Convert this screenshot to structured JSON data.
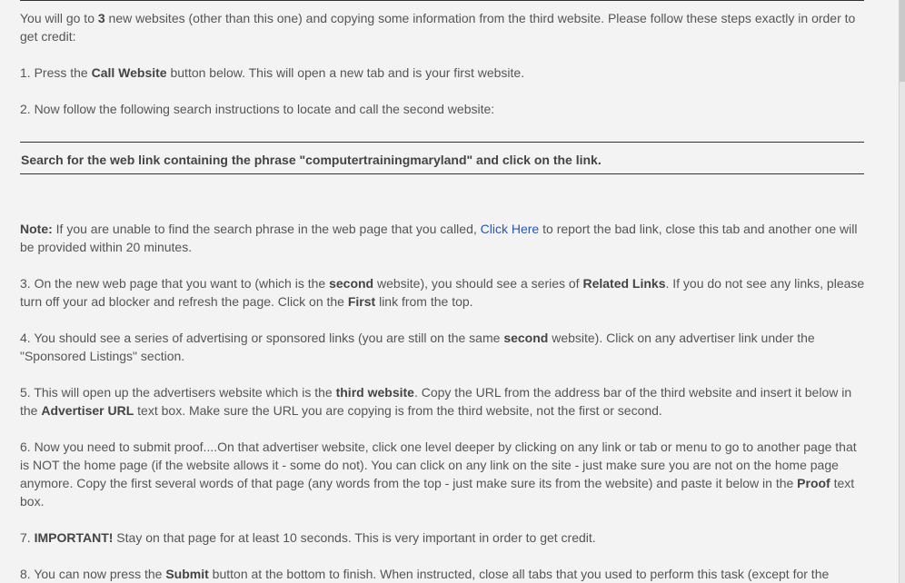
{
  "intro": {
    "t1": "You will go to ",
    "b1": "3",
    "t2": " new websites (other than this one) and copying some information from the third website. Please follow these steps exactly in order to get credit:"
  },
  "step1": {
    "t1": "1. Press the ",
    "b1": "Call Website",
    "t2": " button below. This will open a new tab and is your first website."
  },
  "step2": {
    "t1": "2. Now follow the following search instructions to locate and call the second website:"
  },
  "search_instruction": "Search for the web link containing the phrase \"computertrainingmaryland\" and click on the link.",
  "note": {
    "label": "Note:",
    "t1": " If you are unable to find the search phrase in the web page that you called, ",
    "link": "Click Here",
    "t2": " to report the bad link, close this tab and another one will be provided within 20 minutes."
  },
  "step3": {
    "t1": "3. On the new web page that you want to (which is the ",
    "b1": "second",
    "t2": " website), you should see a series of ",
    "b2": "Related Links",
    "t3": ". If you do not see any links, please turn off your ad blocker and refresh the page. Click on the ",
    "b3": "First",
    "t4": " link from the top."
  },
  "step4": {
    "t1": "4. You should see a series of advertising or sponsored links (you are still on the same ",
    "b1": "second",
    "t2": " website). Click on any advertiser link under the \"Sponsored Listings\" section."
  },
  "step5": {
    "t1": "5. This will open up the advertisers website which is the ",
    "b1": "third website",
    "t2": ". Copy the URL from the address bar of the third website and insert it below in the ",
    "b2": "Advertiser URL",
    "t3": " text box. Make sure the URL you are copying is from the third website, not the first or second."
  },
  "step6": {
    "t1": "6. Now you need to submit proof....On that advertiser website, click one level deeper by clicking on any link or tab or menu to go to another page that is NOT the home page (if the website allows it - some do not). You can click on any link on the site - just make sure you are not on the home page anymore. Copy the first several words of that page (any words from the top - just make sure its from the website) and paste it below in the ",
    "b1": "Proof",
    "t2": " text box."
  },
  "step7": {
    "t1": "7. ",
    "b1": "IMPORTANT!",
    "t2": " Stay on that page for at least 10 seconds. This is very important in order to get credit."
  },
  "step8": {
    "t1": "8. You can now press the ",
    "b1": "Submit",
    "t2": " button at the bottom to finish. When instructed, close all tabs that you used to perform this task (except for the"
  }
}
